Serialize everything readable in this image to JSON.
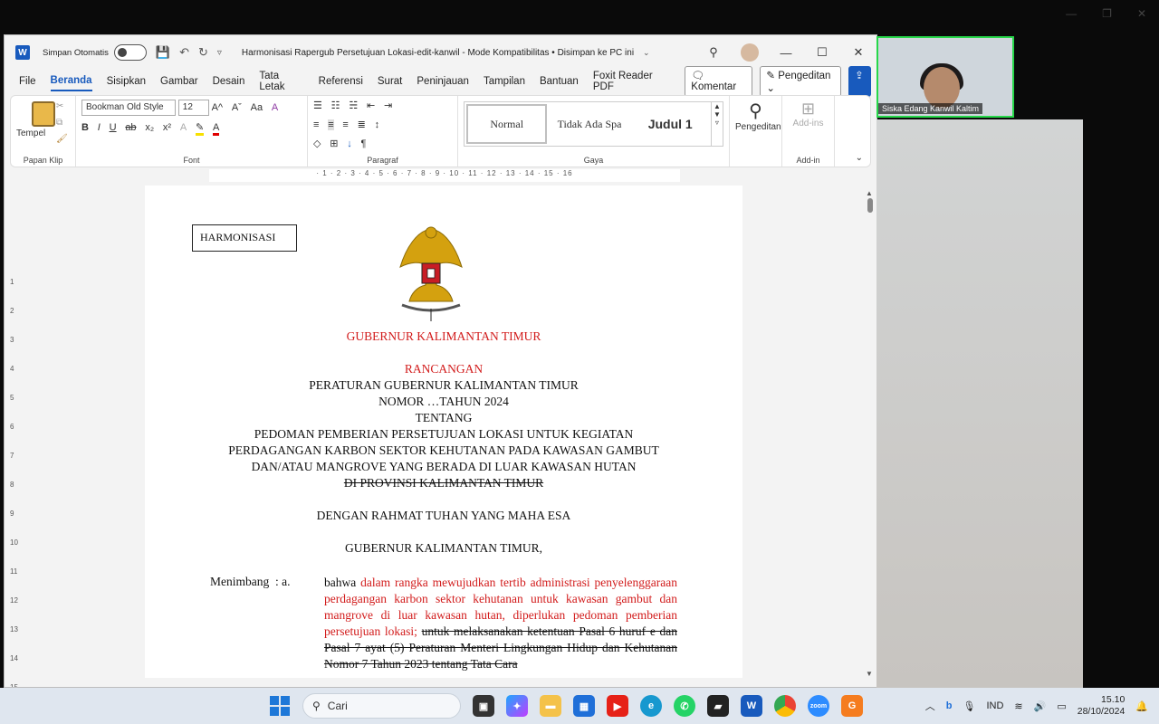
{
  "titlebar": {
    "autosave_label": "Simpan Otomatis",
    "document_title": "Harmonisasi Rapergub Persetujuan Lokasi-edit-kanwil  -  Mode Kompatibilitas • Disimpan ke PC ini"
  },
  "menu": {
    "tabs": [
      "File",
      "Beranda",
      "Sisipkan",
      "Gambar",
      "Desain",
      "Tata Letak",
      "Referensi",
      "Surat",
      "Peninjauan",
      "Tampilan",
      "Bantuan",
      "Foxit Reader PDF"
    ],
    "active_tab": "Beranda",
    "comment_button": "Komentar",
    "editing_button": "Pengeditan"
  },
  "ribbon": {
    "paste_label": "Tempel",
    "clipboard_group": "Papan Klip",
    "font_name": "Bookman Old Style",
    "font_size": "12",
    "font_group": "Font",
    "paragraph_group": "Paragraf",
    "styles": [
      "Normal",
      "Tidak Ada Spa",
      "Judul 1"
    ],
    "styles_group": "Gaya",
    "editing_label": "Pengeditan",
    "addins_label": "Add-ins",
    "addin_group": "Add-in"
  },
  "document": {
    "harmonisasi": "HARMONISASI",
    "governor": "GUBERNUR KALIMANTAN TIMUR",
    "draft": "RANCANGAN",
    "regulation": "PERATURAN GUBERNUR KALIMANTAN TIMUR",
    "number": "NOMOR …TAHUN 2024",
    "about": "TENTANG",
    "subject_1": "PEDOMAN PEMBERIAN PERSETUJUAN LOKASI UNTUK KEGIATAN",
    "subject_2": "PERDAGANGAN KARBON SEKTOR KEHUTANAN PADA KAWASAN GAMBUT",
    "subject_3": "DAN/ATAU MANGROVE YANG BERADA DI LUAR KAWASAN HUTAN",
    "subject_struck": "DI PROVINSI KALIMANTAN TIMUR",
    "grace": "DENGAN RAHMAT TUHAN YANG MAHA ESA",
    "governor_comma": "GUBERNUR KALIMANTAN TIMUR,",
    "considering": "Menimbang",
    "colon_a": ":   a.",
    "para_black": "bahwa",
    "para_red": "dalam rangka mewujudkan tertib administrasi penyelenggaraan perdagangan karbon sektor kehutanan untuk kawasan gambut dan mangrove di luar kawasan hutan, diperlukan pedoman pemberian persetujuan lokasi;",
    "para_struck": "untuk melaksanakan ketentuan Pasal 6 huruf e dan Pasal 7 ayat (5) Peraturan Menteri Lingkungan Hidup dan Kehutanan Nomor 7 Tahun 2023 tentang Tata Cara"
  },
  "zoom": {
    "participant_name": "Siska Edang Kanwil Kaltim"
  },
  "taskbar": {
    "search_placeholder": "Cari",
    "language": "IND",
    "time": "15.10",
    "date": "28/10/2024"
  },
  "colors": {
    "accent": "#185abd",
    "red_text": "#d21c1c",
    "zoom_border": "#27d84a"
  }
}
